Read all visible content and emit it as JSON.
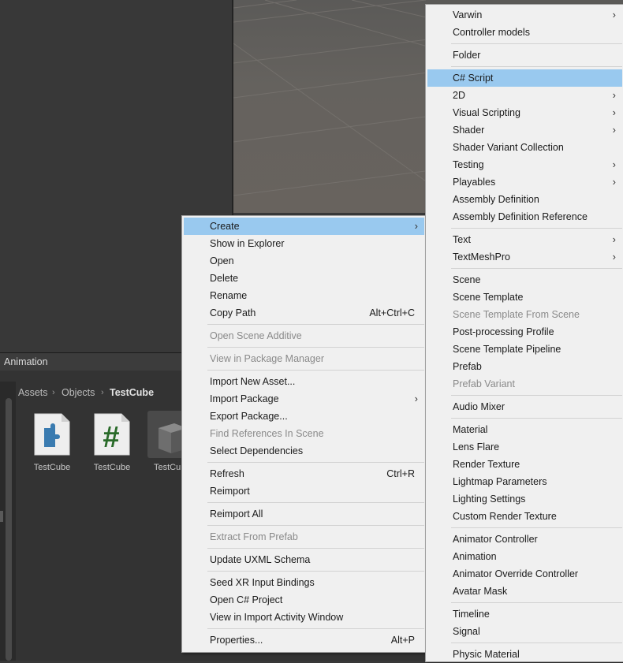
{
  "panel": {
    "tab_title": "Animation",
    "breadcrumb": [
      "Assets",
      "Objects",
      "TestCube"
    ],
    "breadcrumb_separator": "›",
    "assets": [
      {
        "name": "TestCube",
        "icon": "assembly-definition-icon"
      },
      {
        "name": "TestCube",
        "icon": "csharp-script-icon"
      },
      {
        "name": "TestCube",
        "icon": "prefab-cube-icon"
      }
    ],
    "script_glyph": "#"
  },
  "context_menu": {
    "arrow": "›",
    "items": [
      {
        "label": "Create",
        "submenu": true,
        "highlighted": true
      },
      {
        "label": "Show in Explorer"
      },
      {
        "label": "Open"
      },
      {
        "label": "Delete"
      },
      {
        "label": "Rename"
      },
      {
        "label": "Copy Path",
        "shortcut": "Alt+Ctrl+C"
      },
      {
        "label": "Open Scene Additive",
        "disabled": true
      },
      {
        "label": "View in Package Manager",
        "disabled": true
      },
      {
        "label": "Import New Asset..."
      },
      {
        "label": "Import Package",
        "submenu": true
      },
      {
        "label": "Export Package..."
      },
      {
        "label": "Find References In Scene",
        "disabled": true
      },
      {
        "label": "Select Dependencies"
      },
      {
        "label": "Refresh",
        "shortcut": "Ctrl+R"
      },
      {
        "label": "Reimport"
      },
      {
        "label": "Reimport All"
      },
      {
        "label": "Extract From Prefab",
        "disabled": true
      },
      {
        "label": "Update UXML Schema"
      },
      {
        "label": "Seed XR Input Bindings"
      },
      {
        "label": "Open C# Project"
      },
      {
        "label": "View in Import Activity Window"
      },
      {
        "label": "Properties...",
        "shortcut": "Alt+P"
      }
    ]
  },
  "create_submenu": {
    "items": [
      {
        "label": "Varwin",
        "submenu": true
      },
      {
        "label": "Controller models"
      },
      {
        "label": "Folder"
      },
      {
        "label": "C# Script",
        "highlighted": true
      },
      {
        "label": "2D",
        "submenu": true
      },
      {
        "label": "Visual Scripting",
        "submenu": true
      },
      {
        "label": "Shader",
        "submenu": true
      },
      {
        "label": "Shader Variant Collection"
      },
      {
        "label": "Testing",
        "submenu": true
      },
      {
        "label": "Playables",
        "submenu": true
      },
      {
        "label": "Assembly Definition"
      },
      {
        "label": "Assembly Definition Reference"
      },
      {
        "label": "Text",
        "submenu": true
      },
      {
        "label": "TextMeshPro",
        "submenu": true
      },
      {
        "label": "Scene"
      },
      {
        "label": "Scene Template"
      },
      {
        "label": "Scene Template From Scene",
        "disabled": true
      },
      {
        "label": "Post-processing Profile"
      },
      {
        "label": "Scene Template Pipeline"
      },
      {
        "label": "Prefab"
      },
      {
        "label": "Prefab Variant",
        "disabled": true
      },
      {
        "label": "Audio Mixer"
      },
      {
        "label": "Material"
      },
      {
        "label": "Lens Flare"
      },
      {
        "label": "Render Texture"
      },
      {
        "label": "Lightmap Parameters"
      },
      {
        "label": "Lighting Settings"
      },
      {
        "label": "Custom Render Texture"
      },
      {
        "label": "Animator Controller"
      },
      {
        "label": "Animation"
      },
      {
        "label": "Animator Override Controller"
      },
      {
        "label": "Avatar Mask"
      },
      {
        "label": "Timeline"
      },
      {
        "label": "Signal"
      },
      {
        "label": "Physic Material"
      }
    ]
  },
  "colors": {
    "highlight": "#99c9ef",
    "menu_bg": "#f0f0f0",
    "editor_bg": "#383838",
    "script_icon_green": "#2a6b2a",
    "asmdef_icon_blue": "#3a7bb0"
  }
}
